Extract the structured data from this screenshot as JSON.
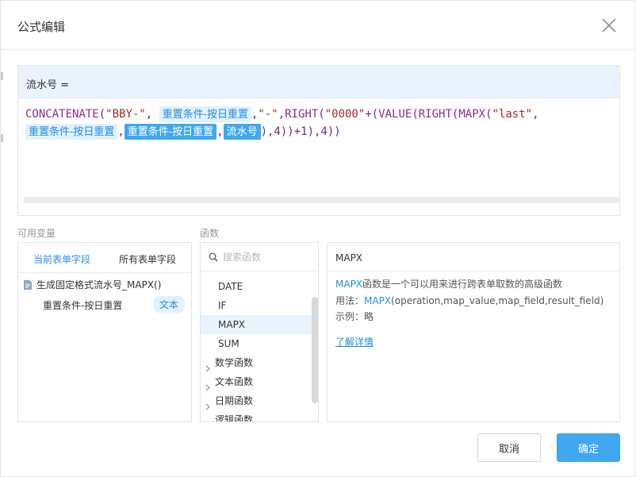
{
  "dialog": {
    "title": "公式编辑"
  },
  "editor": {
    "target_field": "流水号 =",
    "formula": {
      "f1": "CONCATENATE",
      "p1": "(",
      "s1": "\"BBY-\"",
      "c1": ",",
      "tag1": "重置条件-按日重置",
      "c2": ",",
      "s2": "\"-\"",
      "c3": ",",
      "f2": "RIGHT",
      "p2": "(",
      "s3": "\"0000\"",
      "plus1": "+(",
      "f3": "VALUE",
      "p3": "(",
      "f4": "RIGHT",
      "p4": "(",
      "f5": "MAPX",
      "p5": "(",
      "s4": "\"last\"",
      "c4": ",",
      "tag2": "重置条件-按日重置",
      "c5": ",",
      "tag3": "重置条件-按日重置",
      "c6": ",",
      "tag4": "流水号",
      "tail": "),4))+1),4))"
    }
  },
  "variables": {
    "label": "可用变量",
    "tab_current": "当前表单字段",
    "tab_all": "所有表单字段",
    "form_name": "生成固定格式流水号_MAPX()",
    "field_name": "重置条件-按日重置",
    "field_type": "文本"
  },
  "functions": {
    "label": "函数",
    "search_placeholder": "搜索函数",
    "items": [
      "DATE",
      "IF",
      "MAPX",
      "SUM"
    ],
    "selected": "MAPX",
    "categories": [
      "数学函数",
      "文本函数",
      "日期函数",
      "逻辑函数"
    ]
  },
  "description": {
    "name": "MAPX",
    "line1_hl": "MAPX",
    "line1_rest": "函数是一个可以用来进行跨表单取数的高级函数",
    "line2_prefix": "用法：",
    "line2_hl": "MAPX",
    "line2_rest": "(operation,map_value,map_field,result_field)",
    "line3": "示例：略",
    "link": "了解详情"
  },
  "buttons": {
    "cancel": "取消",
    "ok": "确定"
  },
  "colors": {
    "accent": "#3fa8f0",
    "tag_bg": "#e3f1fc",
    "header_bg": "#e8f3fd"
  }
}
